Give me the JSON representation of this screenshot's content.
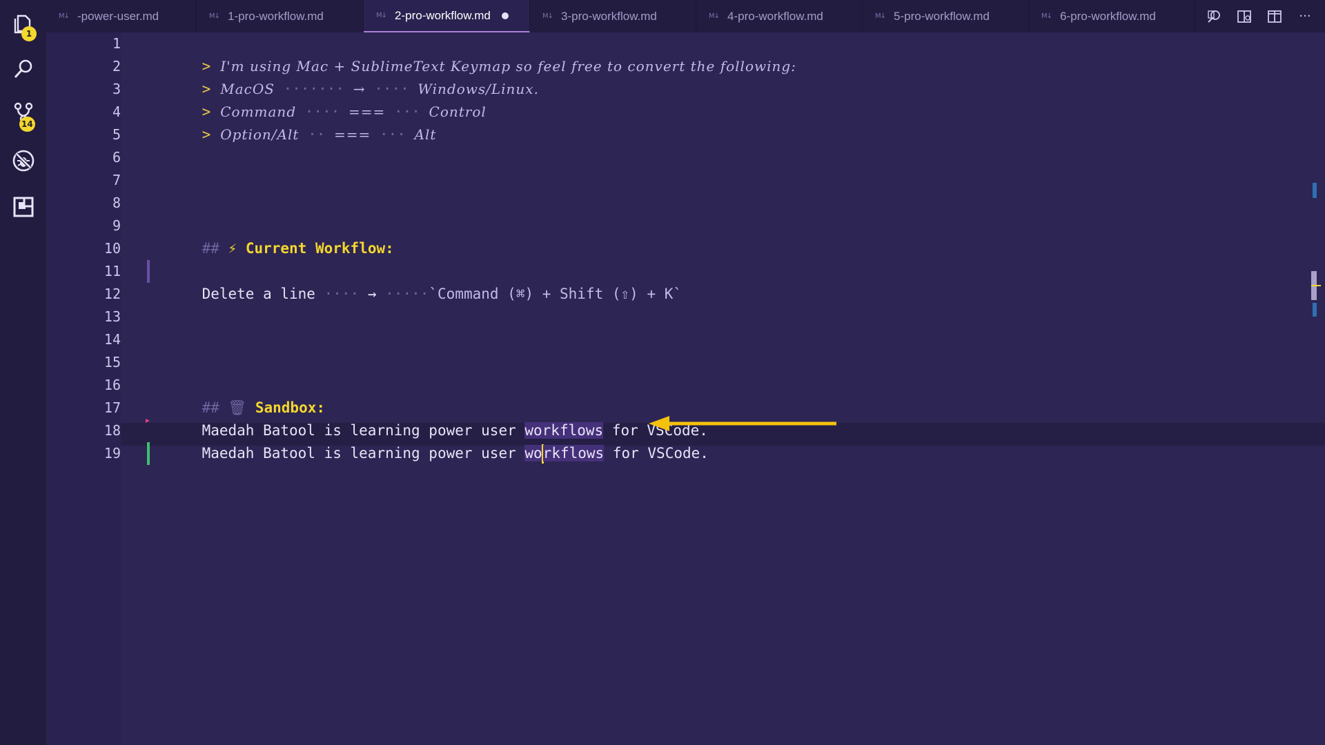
{
  "activity_bar": {
    "explorer_badge": "1",
    "scm_badge": "14"
  },
  "tabs": [
    {
      "label": "-power-user.md",
      "active": false,
      "dirty": false
    },
    {
      "label": "1-pro-workflow.md",
      "active": false,
      "dirty": false
    },
    {
      "label": "2-pro-workflow.md",
      "active": true,
      "dirty": true
    },
    {
      "label": "3-pro-workflow.md",
      "active": false,
      "dirty": false
    },
    {
      "label": "4-pro-workflow.md",
      "active": false,
      "dirty": false
    },
    {
      "label": "5-pro-workflow.md",
      "active": false,
      "dirty": false
    },
    {
      "label": "6-pro-workflow.md",
      "active": false,
      "dirty": false
    }
  ],
  "tab_actions": [
    "open-preview-icon",
    "split-preview-icon",
    "split-editor-icon",
    "more-actions-icon"
  ],
  "line_numbers": [
    "1",
    "2",
    "3",
    "4",
    "5",
    "6",
    "7",
    "8",
    "9",
    "10",
    "11",
    "12",
    "13",
    "14",
    "15",
    "16",
    "17",
    "18",
    "19"
  ],
  "lines": {
    "l1": {
      "marker": ">",
      "text": "I'm using Mac + SublimeText Keymap so feel free to convert the following:"
    },
    "l2": {
      "marker": ">",
      "left": "MacOS",
      "dots1": "·······",
      "op": "→",
      "dots2": "····",
      "right": "Windows/Linux."
    },
    "l3": {
      "marker": ">",
      "left": "Command",
      "dots1": "····",
      "op": "===",
      "dots2": "···",
      "right": "Control"
    },
    "l4": {
      "marker": ">",
      "left": "Option/Alt",
      "dots1": "··",
      "op": "===",
      "dots2": "···",
      "right": "Alt"
    },
    "l9": {
      "hashes": "##",
      "emoji": "⚡",
      "text": "Current Workflow:"
    },
    "l11": {
      "left": "Delete a line",
      "dots1": "····",
      "op": "→",
      "dots2": "·····",
      "code": "`Command (⌘) + Shift (⇧) + K`"
    },
    "l15": {
      "hashes": "##",
      "emoji": "🗑",
      "text": "Sandbox:"
    },
    "l17": {
      "before": "Maedah Batool is learning power user ",
      "match": "workflows",
      "after": " for VSCode."
    },
    "l18": {
      "before": "Maedah Batool is learning power user ",
      "match_a": "wo",
      "match_b": "rkflows",
      "after": " for VSCode."
    }
  },
  "colors": {
    "background": "#2d2553",
    "accent": "#f4d72e",
    "highlight": "#45307a",
    "git_added": "#3fbf6f",
    "git_modified": "#6b4ea8"
  }
}
